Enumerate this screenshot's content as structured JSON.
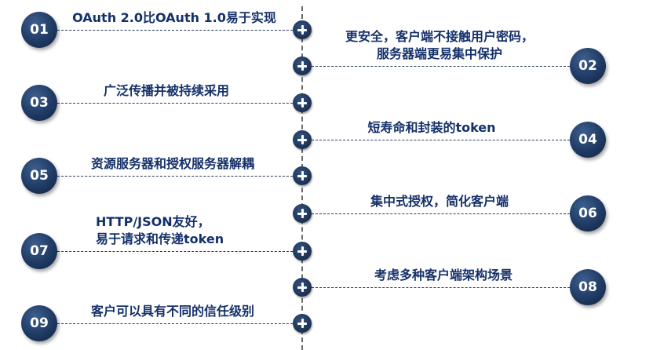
{
  "items": [
    {
      "number": "01",
      "side": "left",
      "lines": [
        "OAuth 2.0比OAuth 1.0易于实现"
      ]
    },
    {
      "number": "02",
      "side": "right",
      "lines": [
        "更安全，客户端不接触用户密码，",
        "服务器端更易集中保护"
      ]
    },
    {
      "number": "03",
      "side": "left",
      "lines": [
        "广泛传播并被持续采用"
      ]
    },
    {
      "number": "04",
      "side": "right",
      "lines": [
        "短寿命和封装的token"
      ]
    },
    {
      "number": "05",
      "side": "left",
      "lines": [
        "资源服务器和授权服务器解耦"
      ]
    },
    {
      "number": "06",
      "side": "right",
      "lines": [
        "集中式授权，简化客户端"
      ]
    },
    {
      "number": "07",
      "side": "left",
      "lines": [
        "HTTP/JSON友好，",
        "易于请求和传递token"
      ]
    },
    {
      "number": "08",
      "side": "right",
      "lines": [
        "考虑多种客户端架构场景"
      ]
    },
    {
      "number": "09",
      "side": "left",
      "lines": [
        "客户可以具有不同的信任级别"
      ]
    }
  ],
  "colors": {
    "badge": "#1f3a63",
    "text": "#14306a",
    "connector": "#2a3a5a",
    "spine": "#6b6b6b"
  },
  "icons": {
    "marker": "plus-icon"
  }
}
